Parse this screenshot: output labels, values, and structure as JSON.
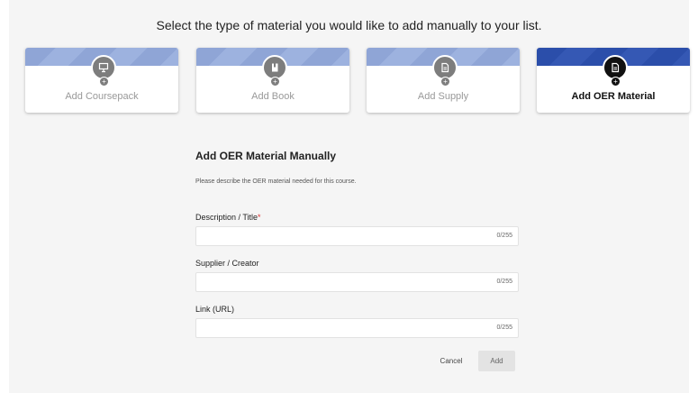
{
  "heading": "Select the type of material you would like to add manually to your list.",
  "cards": [
    {
      "label": "Add Coursepack",
      "icon": "presentation-icon"
    },
    {
      "label": "Add Book",
      "icon": "book-icon"
    },
    {
      "label": "Add Supply",
      "icon": "document-icon"
    },
    {
      "label": "Add OER Material",
      "icon": "document-icon",
      "selected": true
    }
  ],
  "form": {
    "title": "Add OER Material Manually",
    "description": "Please describe the OER material needed for this course.",
    "fields": [
      {
        "label": "Description / Title",
        "required_mark": "*",
        "value": "",
        "counter": "0/255"
      },
      {
        "label": "Supplier / Creator",
        "value": "",
        "counter": "0/255"
      },
      {
        "label": "Link (URL)",
        "value": "",
        "counter": "0/255"
      }
    ],
    "cancel_label": "Cancel",
    "add_label": "Add"
  },
  "colors": {
    "card_band": "#8fa5d6",
    "card_band_active": "#2b4eaa",
    "icon_circle": "#7d7d7d",
    "icon_circle_active": "#111111"
  }
}
